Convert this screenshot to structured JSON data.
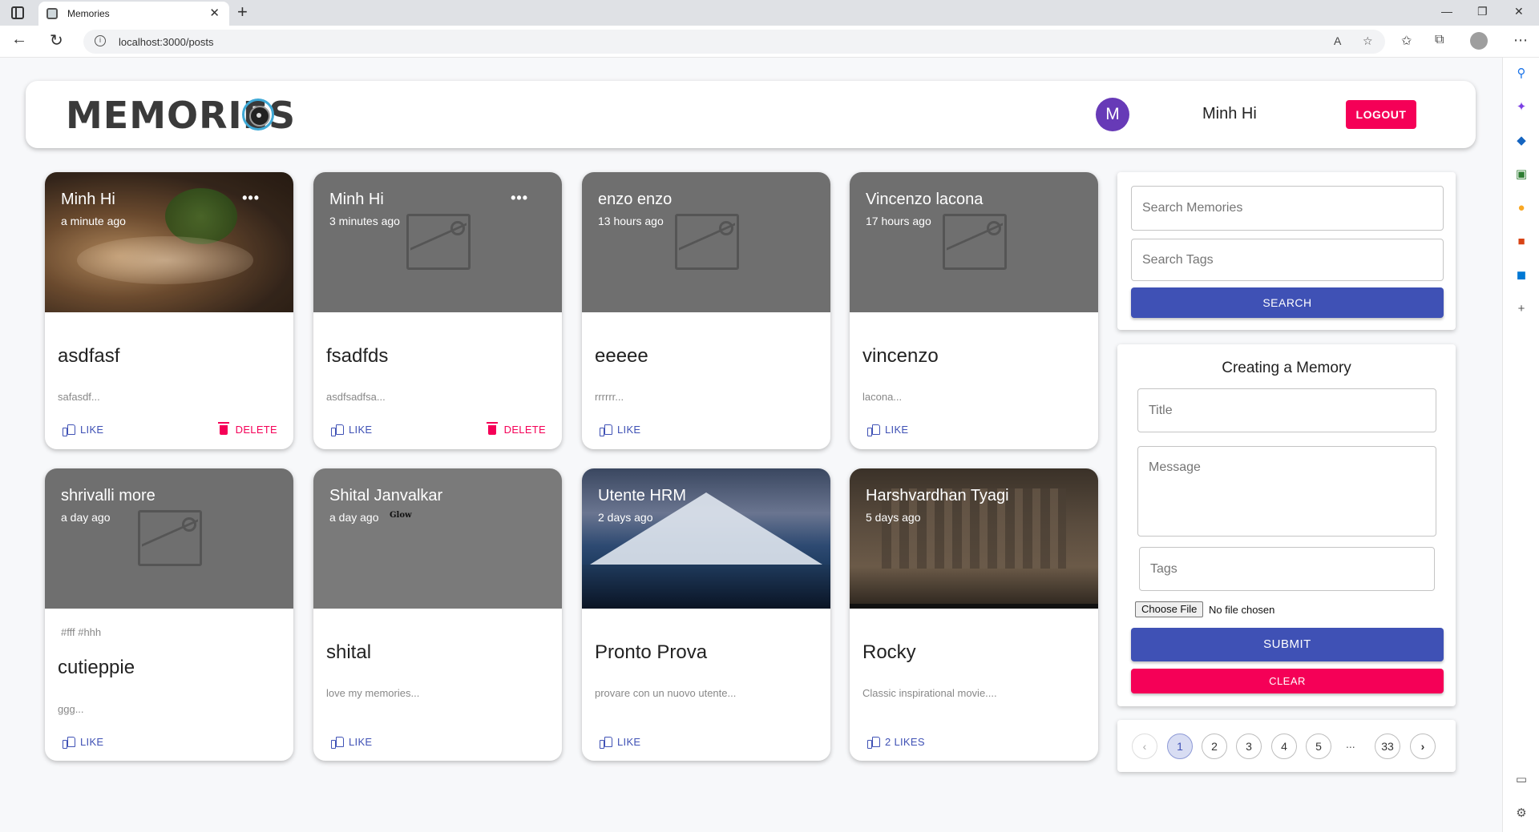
{
  "browser": {
    "tab_title": "Memories",
    "url": "localhost:3000/posts"
  },
  "header": {
    "brand": "MEMORIES",
    "avatar_letter": "M",
    "user_name": "Minh Hi",
    "logout_label": "LOGOUT"
  },
  "posts": [
    {
      "author": "Minh Hi",
      "time": "a minute ago",
      "tags": "",
      "title": "asdfasf",
      "message": "safasdf...",
      "like": "LIKE",
      "delete": "DELETE"
    },
    {
      "author": "Minh Hi",
      "time": "3 minutes ago",
      "tags": "",
      "title": "fsadfds",
      "message": "asdfsadfsa...",
      "like": "LIKE",
      "delete": "DELETE"
    },
    {
      "author": "enzo enzo",
      "time": "13 hours ago",
      "tags": "",
      "title": "eeeee",
      "message": "rrrrrr...",
      "like": "LIKE"
    },
    {
      "author": "Vincenzo lacona",
      "time": "17 hours ago",
      "tags": "",
      "title": "vincenzo",
      "message": "lacona...",
      "like": "LIKE"
    },
    {
      "author": "shrivalli more",
      "time": "a day ago",
      "tags": "#fff #hhh",
      "title": "cutieppie",
      "message": "ggg...",
      "like": "LIKE"
    },
    {
      "author": "Shital Janvalkar",
      "time": "a day ago",
      "image_text": "Glow",
      "tags": "",
      "title": "shital",
      "message": "love my memories...",
      "like": "LIKE"
    },
    {
      "author": "Utente HRM",
      "time": "2 days ago",
      "tags": "",
      "title": "Pronto Prova",
      "message": "provare con un nuovo utente...",
      "like": "LIKE"
    },
    {
      "author": "Harshvardhan Tyagi",
      "time": "5 days ago",
      "tags": "",
      "title": "Rocky",
      "message": "Classic inspirational movie....",
      "like": "2 LIKES"
    }
  ],
  "search": {
    "memories_placeholder": "Search Memories",
    "tags_placeholder": "Search Tags",
    "button": "SEARCH"
  },
  "form": {
    "title": "Creating a Memory",
    "title_placeholder": "Title",
    "message_placeholder": "Message",
    "tags_placeholder": "Tags",
    "file_button": "Choose File",
    "file_status": "No file chosen",
    "submit": "SUBMIT",
    "clear": "CLEAR"
  },
  "pagination": {
    "pages": [
      "1",
      "2",
      "3",
      "4",
      "5"
    ],
    "ellipsis": "...",
    "last": "33",
    "current": "1"
  },
  "colors": {
    "primary": "#3f51b5",
    "secondary": "#f50057",
    "avatar": "#673ab7"
  }
}
